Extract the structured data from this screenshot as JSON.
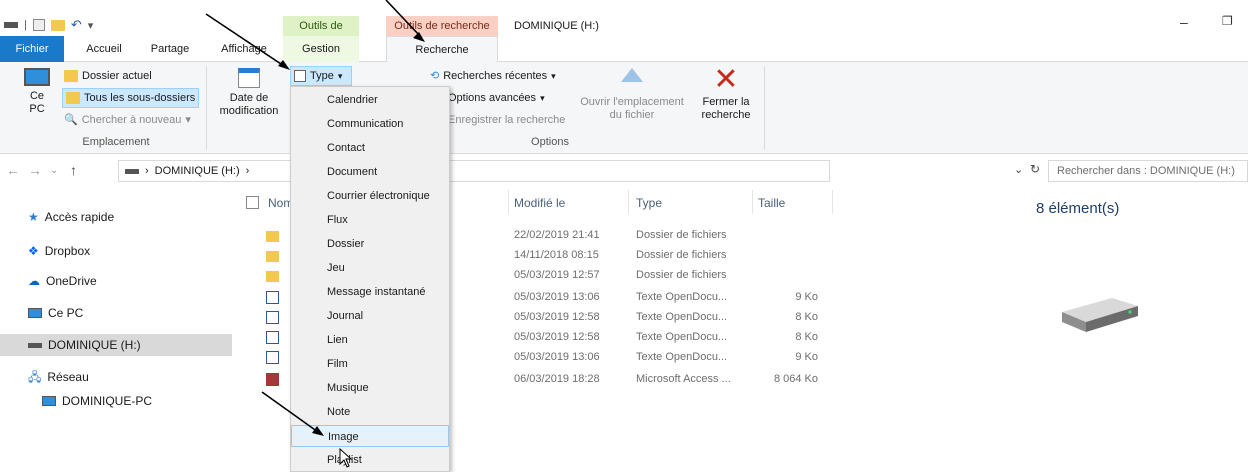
{
  "window": {
    "title": "DOMINIQUE (H:)",
    "context_green": "Outils de lecteur",
    "context_pink": "Outils de recherche",
    "controls": [
      "–",
      "❐"
    ]
  },
  "tabs": {
    "fichier": "Fichier",
    "accueil": "Accueil",
    "partage": "Partage",
    "affichage": "Affichage",
    "gestion": "Gestion",
    "recherche": "Recherche"
  },
  "ribbon": {
    "ce_pc": "Ce PC",
    "dossier_actuel": "Dossier actuel",
    "tous_sous_dossiers": "Tous les sous-dossiers",
    "chercher_nouveau": "Chercher à nouveau",
    "group_emplacement": "Emplacement",
    "date_modif": "Date de modification",
    "type_button": "Type",
    "recherches_recentes": "Recherches récentes",
    "options_avancees": "Options avancées",
    "enregistrer": "Enregistrer la recherche",
    "ouvrir_emplacement": "Ouvrir l'emplacement du fichier",
    "fermer": "Fermer la recherche",
    "group_options": "Options"
  },
  "address": {
    "path": "DOMINIQUE (H:)",
    "search_placeholder": "Rechercher dans : DOMINIQUE (H:)"
  },
  "nav": {
    "acces_rapide": "Accès rapide",
    "dropbox": "Dropbox",
    "onedrive": "OneDrive",
    "ce_pc": "Ce PC",
    "dominique": "DOMINIQUE (H:)",
    "reseau": "Réseau",
    "dominique_pc": "DOMINIQUE-PC"
  },
  "columns": {
    "name": "Nom",
    "modified": "Modifié le",
    "type": "Type",
    "size": "Taille"
  },
  "rows": [
    {
      "modified": "22/02/2019 21:41",
      "type": "Dossier de fichiers",
      "size": "",
      "icon": "folder-icon"
    },
    {
      "modified": "14/11/2018 08:15",
      "type": "Dossier de fichiers",
      "size": "",
      "icon": "folder-icon"
    },
    {
      "modified": "05/03/2019 12:57",
      "type": "Dossier de fichiers",
      "size": "",
      "icon": "folder-icon"
    },
    {
      "modified": "05/03/2019 13:06",
      "type": "Texte OpenDocu...",
      "size": "9 Ko",
      "icon": "document-icon"
    },
    {
      "modified": "05/03/2019 12:58",
      "type": "Texte OpenDocu...",
      "size": "8 Ko",
      "icon": "document-icon"
    },
    {
      "modified": "05/03/2019 12:58",
      "type": "Texte OpenDocu...",
      "size": "8 Ko",
      "icon": "document-icon"
    },
    {
      "modified": "05/03/2019 13:06",
      "type": "Texte OpenDocu...",
      "size": "9 Ko",
      "icon": "document-icon"
    },
    {
      "modified": "06/03/2019 18:28",
      "type": "Microsoft Access ...",
      "size": "8 064 Ko",
      "icon": "access-icon"
    }
  ],
  "details": {
    "count": "8 élément(s)"
  },
  "type_menu": {
    "items": [
      "Calendrier",
      "Communication",
      "Contact",
      "Document",
      "Courrier électronique",
      "Flux",
      "Dossier",
      "Jeu",
      "Message instantané",
      "Journal",
      "Lien",
      "Film",
      "Musique",
      "Note",
      "Image",
      "Playlist"
    ],
    "hovered": "Image"
  },
  "colors": {
    "fichier_tab": "#1979ca",
    "close_x": "#c42b1c",
    "highlight": "#cce8ff"
  }
}
